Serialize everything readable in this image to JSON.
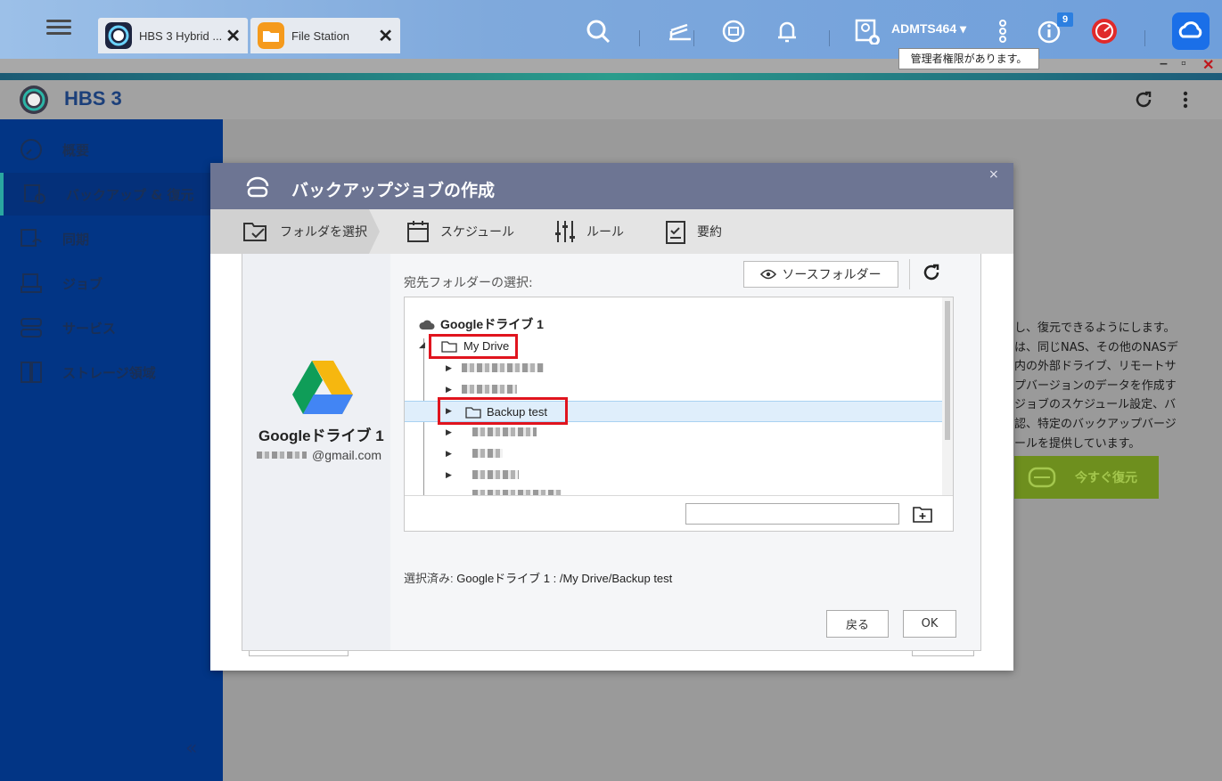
{
  "topbar": {
    "tabs": [
      {
        "label": "HBS 3 Hybrid ...",
        "icon": "hbs3-app-icon"
      },
      {
        "label": "File Station",
        "icon": "file-station-icon"
      }
    ],
    "user": "ADMTS464 ▾",
    "notification_badge": "9",
    "tooltip": "管理者権限があります。"
  },
  "app": {
    "title": "HBS 3"
  },
  "sidebar": {
    "items": [
      {
        "label": "概要",
        "icon": "gauge-icon"
      },
      {
        "label": "バックアップ & 復元",
        "icon": "backup-restore-icon"
      },
      {
        "label": "同期",
        "icon": "sync-icon"
      },
      {
        "label": "ジョブ",
        "icon": "jobs-icon"
      },
      {
        "label": "サービス",
        "icon": "services-icon"
      },
      {
        "label": "ストレージ領域",
        "icon": "storage-icon"
      }
    ],
    "collapse": "«"
  },
  "background": {
    "description": "し、復元できるようにします。\nは、同じNAS、その他のNASデ\n内の外部ドライブ、リモートサ\nプバージョンのデータを作成す\nジョブのスケジュール設定、バ\n認、特定のバックアップバージ\nールを提供しています。",
    "restore_now": "今すぐ復元"
  },
  "dialog": {
    "title": "バックアップジョブの作成",
    "close": "×",
    "steps": [
      {
        "label": "フォルダを選択",
        "icon": "folder-check-icon"
      },
      {
        "label": "スケジュール",
        "icon": "calendar-icon"
      },
      {
        "label": "ルール",
        "icon": "sliders-icon"
      },
      {
        "label": "要約",
        "icon": "clipboard-icon"
      }
    ],
    "account": {
      "name": "Googleドライブ 1",
      "email": "@gmail.com"
    },
    "dest_label": "宛先フォルダーの選択:",
    "source_button": "ソースフォルダー",
    "tree": {
      "root": "Googleドライブ 1",
      "my_drive": "My Drive",
      "selected_folder": "Backup test"
    },
    "new_folder_placeholder": "",
    "selected_prefix": "選択済み:",
    "selected_path": "Googleドライブ 1 : /My Drive/Backup test",
    "back_button": "戻る",
    "ok_button": "OK"
  },
  "colors": {
    "sidebar": "#023585",
    "dialog_header": "#6d7593",
    "highlight": "#e0141e",
    "selection": "#dfeefb"
  }
}
